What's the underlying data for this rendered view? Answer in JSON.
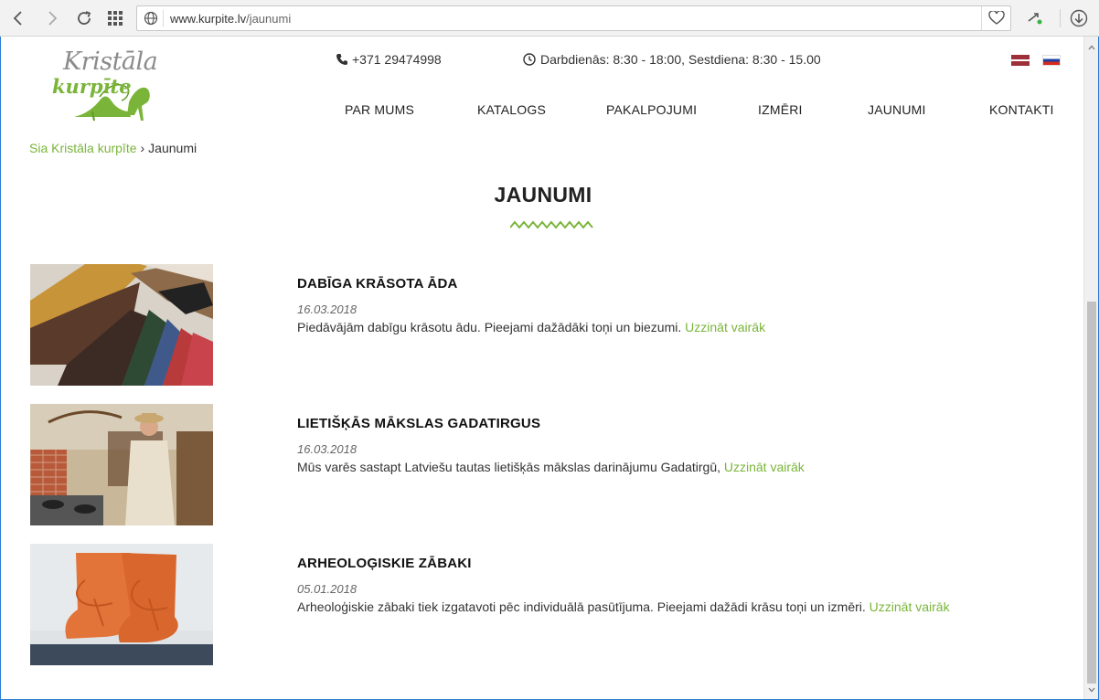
{
  "browser": {
    "url_host": "www.kurpite.lv",
    "url_path": "/jaunumi"
  },
  "site": {
    "logo_line1": "Kristāla",
    "logo_line2": "kurpīte",
    "phone": "+371 29474998",
    "hours": "Darbdienās: 8:30 - 18:00, Sestdiena: 8:30 - 15.00",
    "languages": [
      "lv",
      "ru"
    ]
  },
  "menu": [
    {
      "label": "PAR MUMS"
    },
    {
      "label": "KATALOGS"
    },
    {
      "label": "PAKALPOJUMI"
    },
    {
      "label": "IZMĒRI"
    },
    {
      "label": "JAUNUMI"
    },
    {
      "label": "KONTAKTI"
    }
  ],
  "breadcrumb": {
    "home": "Sia Kristāla kurpīte",
    "separator": "›",
    "current": "Jaunumi"
  },
  "page_title": "JAUNUMI",
  "news": [
    {
      "title": "DABĪGA KRĀSOTA ĀDA",
      "date": "16.03.2018",
      "text": "Piedāvājām dabīgu krāsotu ādu. Pieejami dažādāki toņi un biezumi.",
      "more": "Uzzināt vairāk"
    },
    {
      "title": "LIETIŠĶĀS MĀKSLAS GADATIRGUS",
      "date": "16.03.2018",
      "text": "Mūs varēs sastapt Latviešu tautas lietišķās mākslas darinājumu Gadatirgū,",
      "more": "Uzzināt vairāk"
    },
    {
      "title": "ARHEOLOĢISKIE ZĀBAKI",
      "date": "05.01.2018",
      "text": "Arheoloģiskie zābaki tiek izgatavoti pēc individuālā pasūtījuma. Pieejami dažādi krāsu toņi un izmēri.",
      "more": "Uzzināt vairāk"
    }
  ],
  "colors": {
    "accent": "#7ab539",
    "text": "#222222"
  }
}
